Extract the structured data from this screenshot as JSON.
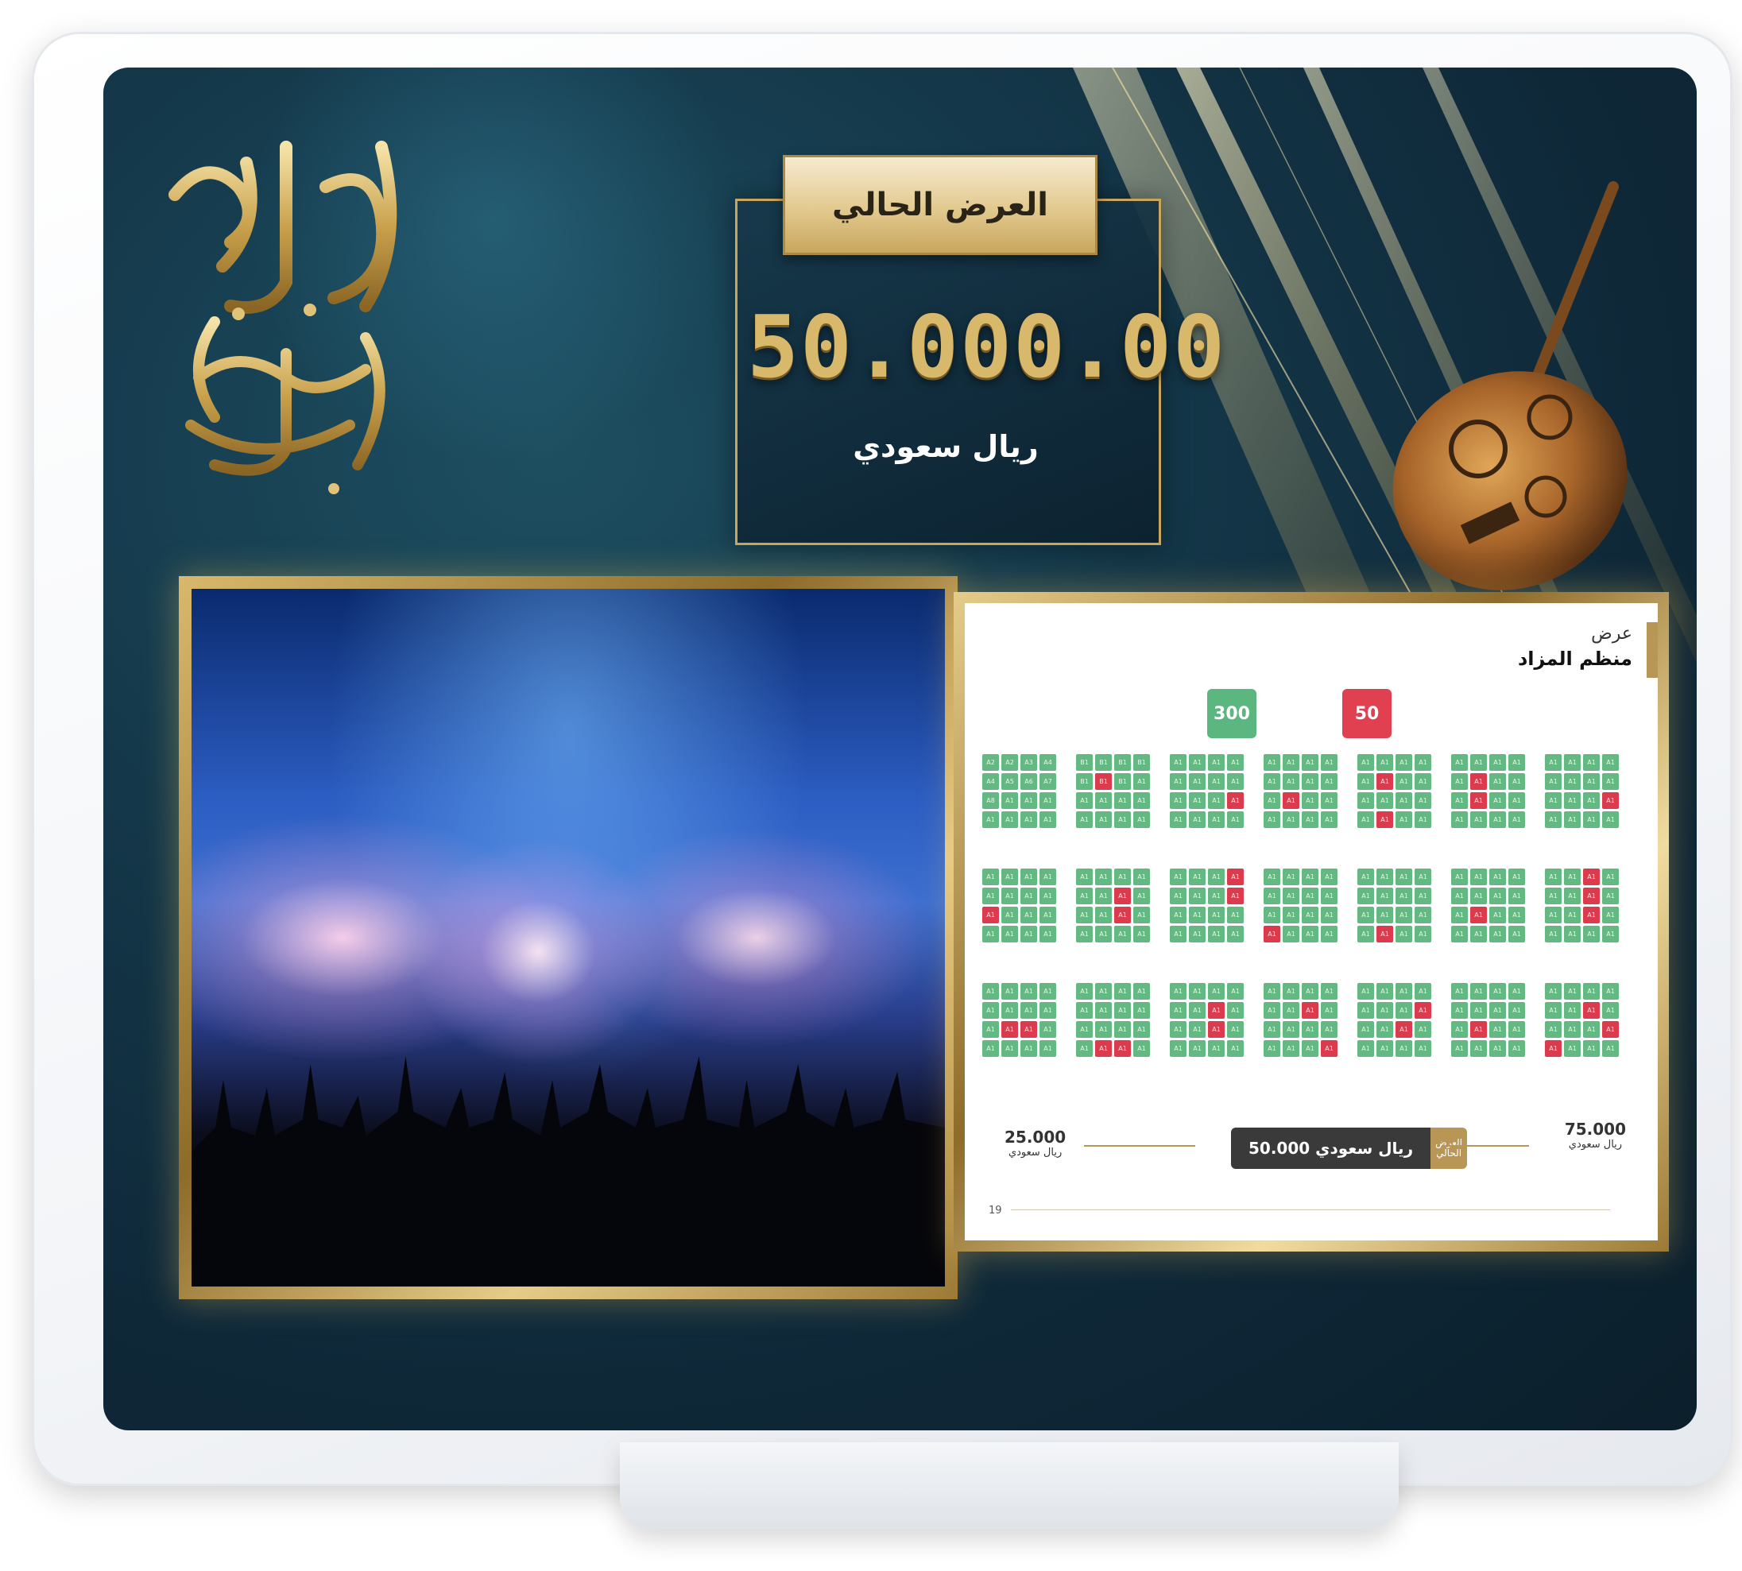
{
  "logo": {
    "text_line1": "ليالي الأساطير",
    "text_line2": "ليلة السندباد"
  },
  "current_bid": {
    "label": "العرض الحالي",
    "amount": "50.000.00",
    "currency": "ريال سعودي"
  },
  "seat_map": {
    "label_small": "عرض",
    "title": "منظم المزاد",
    "price_chips": [
      "300",
      "50"
    ],
    "min_value": "25.000",
    "min_currency": "ريال سعودي",
    "max_value": "75.000",
    "max_currency": "ريال سعودي",
    "current_amount": "50.000 ريال سعودي",
    "current_label": "العرض الحالي",
    "page_number": "19",
    "seat_labels_row1": [
      "A2",
      "A2",
      "A3",
      "A4",
      "A4",
      "A5",
      "A6",
      "A7",
      "A8",
      "A1",
      "A1",
      "A1",
      "A1",
      "A1",
      "A1",
      "A1"
    ],
    "seat_labels_row2": [
      "B1",
      "B1",
      "B1",
      "B1",
      "B1",
      "B1",
      "B1",
      "A1",
      "A1",
      "A1",
      "A1",
      "A1",
      "A1",
      "A1",
      "A1",
      "A1"
    ],
    "seat_label_default": "A1"
  },
  "colors": {
    "accent_gold": "#c9a65a",
    "available": "#63b981",
    "taken": "#dc3b4d",
    "background": "#0e2737"
  }
}
